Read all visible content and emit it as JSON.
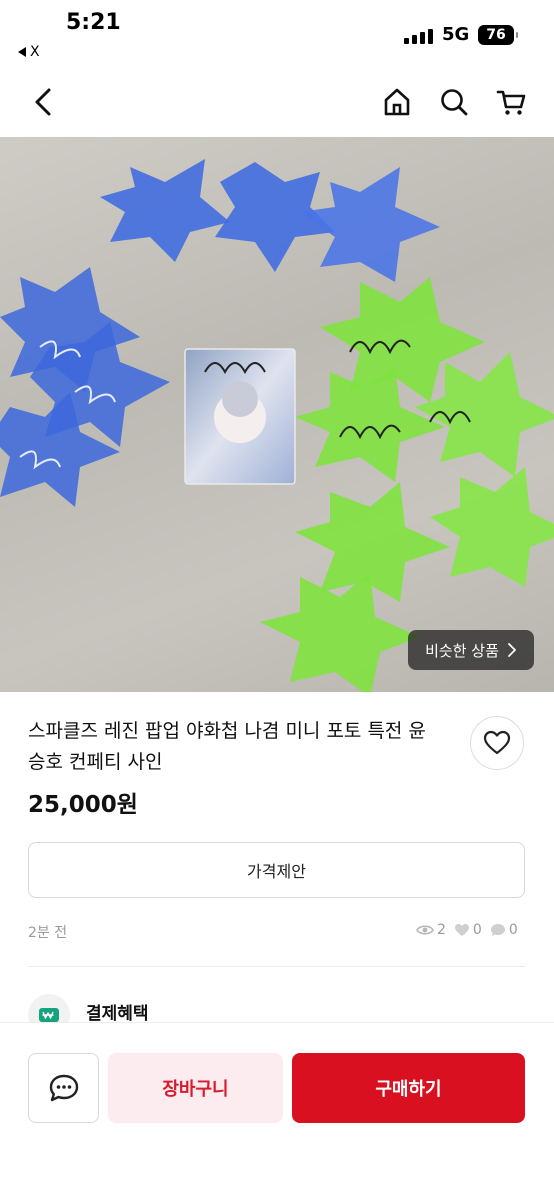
{
  "status_bar": {
    "time": "5:21",
    "back_app": "X",
    "network": "5G",
    "battery": "76"
  },
  "nav": {
    "back_icon": "chevron-left-icon",
    "home_icon": "home-icon",
    "search_icon": "search-icon",
    "cart_icon": "cart-icon"
  },
  "product": {
    "similar_label": "비슷한 상품",
    "title": "스파클즈 레진 팝업 야화첩 나겸 미니 포토 특전 윤승호 컨페티 사인",
    "price": "25,000원",
    "offer_label": "가격제안",
    "posted": "2분 전",
    "views": "2",
    "likes": "0",
    "chats": "0"
  },
  "benefit": {
    "label": "결제혜택"
  },
  "actions": {
    "cart_label": "장바구니",
    "buy_label": "구매하기"
  },
  "colors": {
    "accent": "#d8101f",
    "cart_bg": "#fdecef"
  }
}
